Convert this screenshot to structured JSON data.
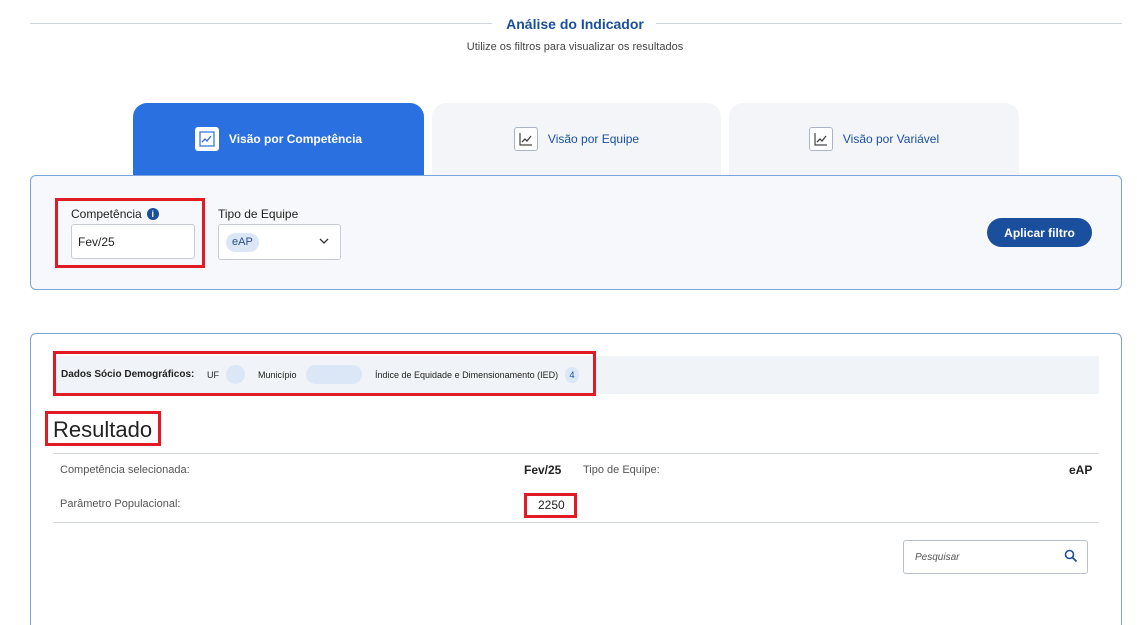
{
  "header": {
    "title": "Análise do Indicador",
    "subtitle": "Utilize os filtros para visualizar os resultados"
  },
  "tabs": [
    {
      "label": "Visão por Competência",
      "icon": "line-chart-icon",
      "active": true
    },
    {
      "label": "Visão por Equipe",
      "icon": "line-chart-icon",
      "active": false
    },
    {
      "label": "Visão por Variável",
      "icon": "line-chart-icon",
      "active": false
    }
  ],
  "filters": {
    "competencia_label": "Competência",
    "competencia_value": "Fev/25",
    "tipo_equipe_label": "Tipo de Equipe",
    "tipo_equipe_value": "eAP",
    "apply_label": "Aplicar filtro"
  },
  "demographics": {
    "title": "Dados Sócio Demográficos:",
    "uf_label": "UF",
    "municipio_label": "Município",
    "ied_label": "Índice de Equidade e Dimensionamento (IED)",
    "ied_value": "4"
  },
  "result": {
    "title": "Resultado",
    "competencia_label": "Competência selecionada:",
    "competencia_value": "Fev/25",
    "tipo_equipe_label": "Tipo de Equipe:",
    "tipo_equipe_value": "eAP",
    "parametro_label": "Parâmetro Populacional:",
    "parametro_value": "2250"
  },
  "search": {
    "placeholder": "Pesquisar"
  },
  "colors": {
    "primary": "#1a4f9e",
    "active_tab": "#2a70e0",
    "highlight": "#e01b24"
  }
}
